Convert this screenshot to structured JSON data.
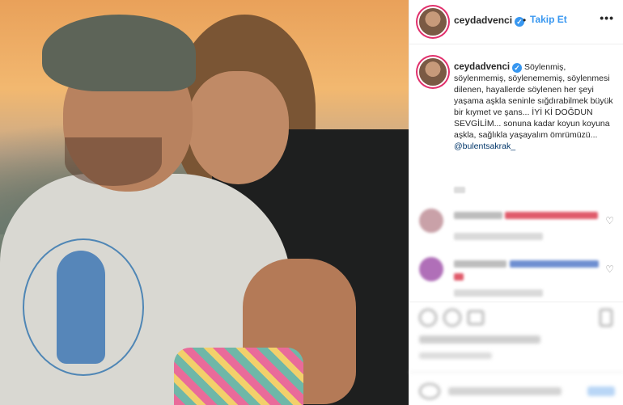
{
  "post": {
    "username": "ceydadvenci",
    "follow_label": "Takip Et",
    "dot": "•",
    "more_label": "•••",
    "verified_mark": "✓"
  },
  "caption": {
    "username": "ceydadvenci",
    "text": "Söylenmiş, söylenmemiş, söylenememiş, söylenmesi dilenen, hayallerde söylenen her şeyi yaşama aşkla seninle sığdırabilmek büyük bir kıymet ve şans... İYİ Kİ DOĞDUN SEVGİLİM... sonuna kadar koyun koyuna aşkla, sağlıkla yaşayalım ömrümüzü...",
    "mention": "@bulentsakrak_"
  },
  "comments": [
    {
      "avatar_color": "#c9a1a8",
      "line1_color": "#e05a6a",
      "line2_color": "#cfcfcf",
      "like_icon": "heart-icon"
    },
    {
      "avatar_color": "#b06fb8",
      "line1_color": "#6e8fd1",
      "line2_color": "#cfcfcf",
      "like_icon": "heart-icon"
    }
  ],
  "colors": {
    "accent": "#3897f0",
    "story_ring": "#e1306c",
    "text": "#262626",
    "muted": "#8e8e8e"
  }
}
